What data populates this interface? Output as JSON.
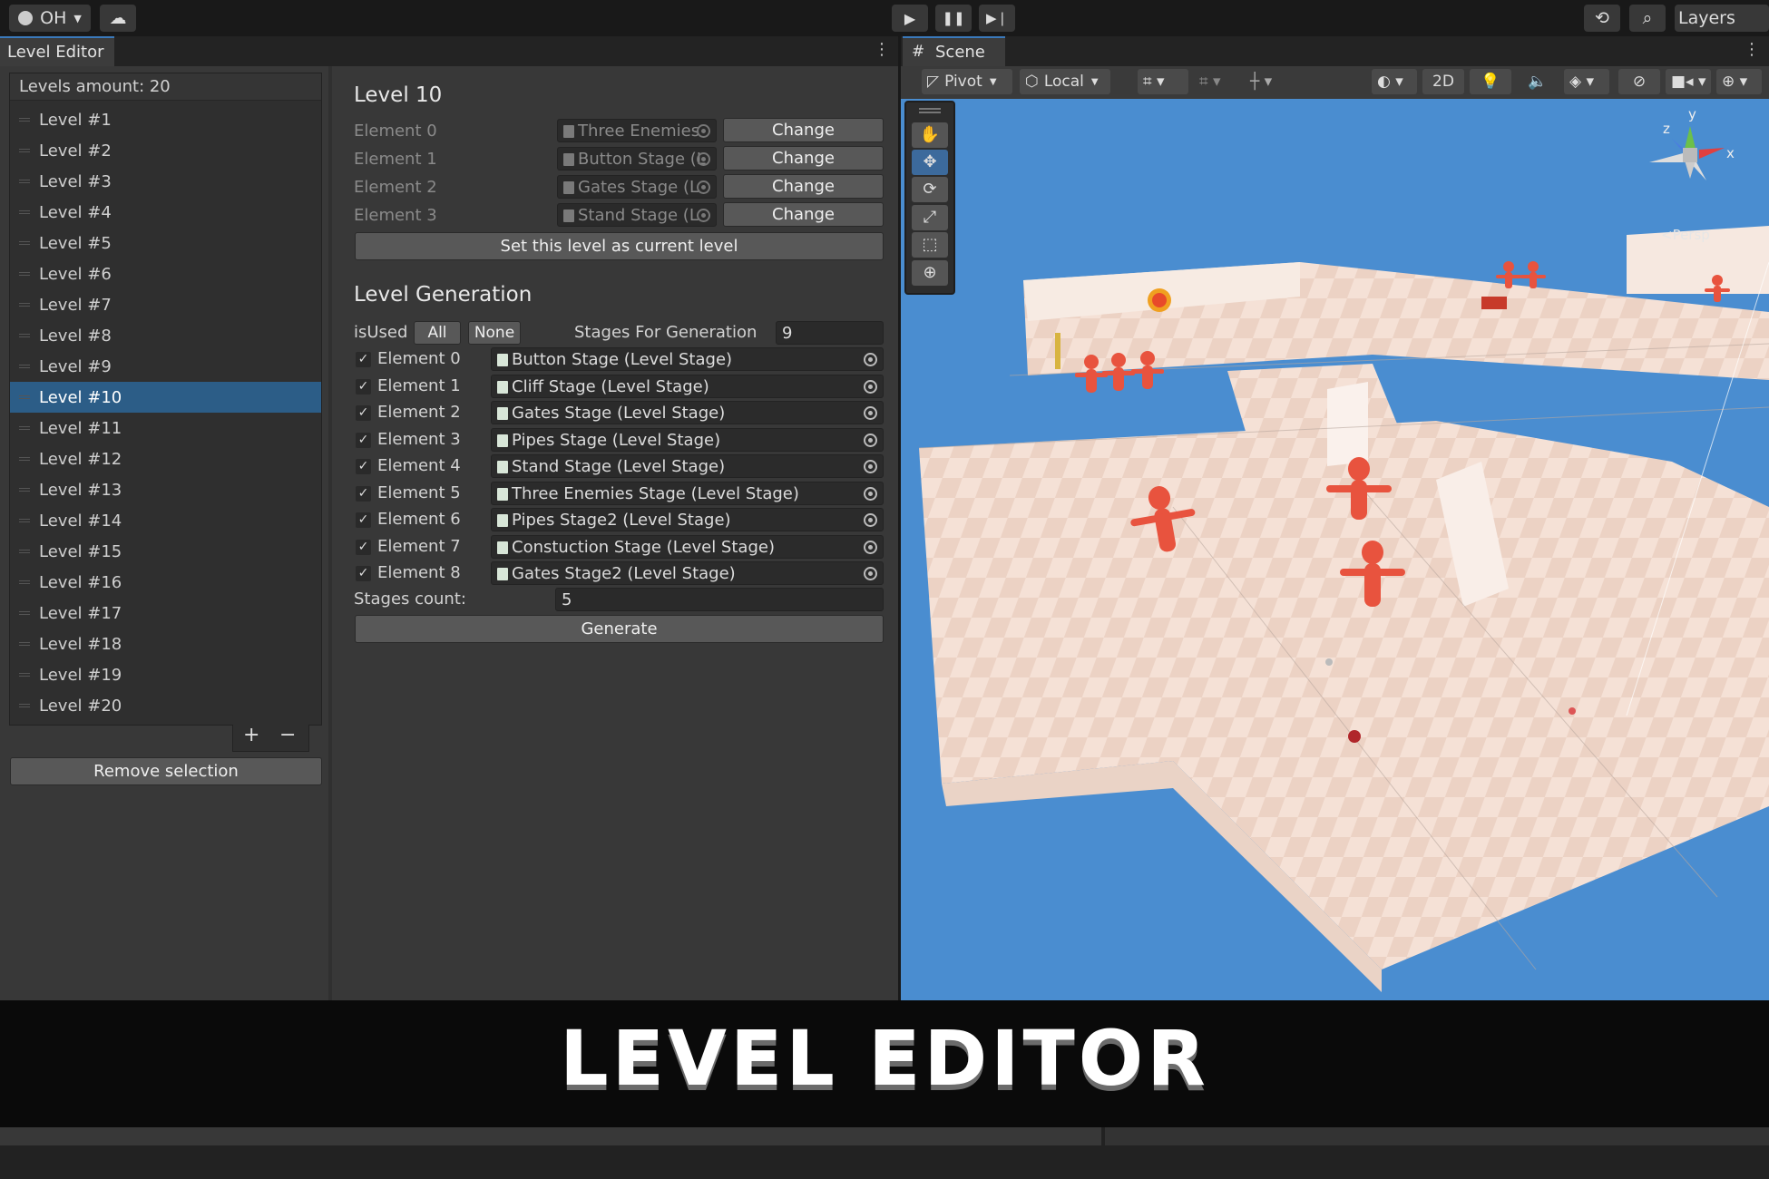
{
  "toolbar": {
    "account_label": "OH"
  },
  "scene_header": {
    "layers_label": "Layers"
  },
  "level_editor": {
    "tab_title": "Level Editor",
    "levels_amount": "Levels amount: 20",
    "levels": [
      "Level #1",
      "Level #2",
      "Level #3",
      "Level #4",
      "Level #5",
      "Level #6",
      "Level #7",
      "Level #8",
      "Level #9",
      "Level #10",
      "Level #11",
      "Level #12",
      "Level #13",
      "Level #14",
      "Level #15",
      "Level #16",
      "Level #17",
      "Level #18",
      "Level #19",
      "Level #20"
    ],
    "selected_level": "Level #10",
    "add_label": "+",
    "remove_label": "−",
    "remove_selection_label": "Remove selection"
  },
  "level_detail": {
    "title": "Level 10",
    "elements": [
      {
        "label": "Element 0",
        "value": "Three Enemies",
        "button": "Change"
      },
      {
        "label": "Element 1",
        "value": "Button Stage (L",
        "button": "Change"
      },
      {
        "label": "Element 2",
        "value": "Gates Stage (L",
        "button": "Change"
      },
      {
        "label": "Element 3",
        "value": "Stand Stage (L",
        "button": "Change"
      }
    ],
    "set_current_label": "Set this level as current level"
  },
  "generation": {
    "title": "Level Generation",
    "is_used_label": "isUsed",
    "all_label": "All",
    "none_label": "None",
    "stages_for_generation_label": "Stages For Generation",
    "stages_for_generation_value": "9",
    "items": [
      {
        "label": "Element 0",
        "value": "Button Stage (Level Stage)",
        "checked": true
      },
      {
        "label": "Element 1",
        "value": "Cliff Stage (Level Stage)",
        "checked": true
      },
      {
        "label": "Element 2",
        "value": "Gates Stage (Level Stage)",
        "checked": true
      },
      {
        "label": "Element 3",
        "value": "Pipes Stage (Level Stage)",
        "checked": true
      },
      {
        "label": "Element 4",
        "value": "Stand Stage (Level Stage)",
        "checked": true
      },
      {
        "label": "Element 5",
        "value": "Three Enemies Stage (Level Stage)",
        "checked": true
      },
      {
        "label": "Element 6",
        "value": "Pipes Stage2 (Level Stage)",
        "checked": true
      },
      {
        "label": "Element 7",
        "value": "Constuction Stage (Level Stage)",
        "checked": true
      },
      {
        "label": "Element 8",
        "value": "Gates Stage2 (Level Stage)",
        "checked": true
      }
    ],
    "stages_count_label": "Stages count:",
    "stages_count_value": "5",
    "generate_label": "Generate"
  },
  "scene": {
    "tab_title": "Scene",
    "pivot_label": "Pivot",
    "local_label": "Local",
    "mode_2d_label": "2D",
    "persp_label": "<Persp",
    "gizmo_axes": {
      "y": "y",
      "x": "x",
      "z": "z"
    }
  },
  "banner": {
    "title": "LEVEL EDITOR"
  },
  "colors": {
    "selection": "#2c5d87",
    "accent": "#3a79bb",
    "sky": "#4a8dd0",
    "character": "#e8533e",
    "floor": "#f2dcd0"
  }
}
